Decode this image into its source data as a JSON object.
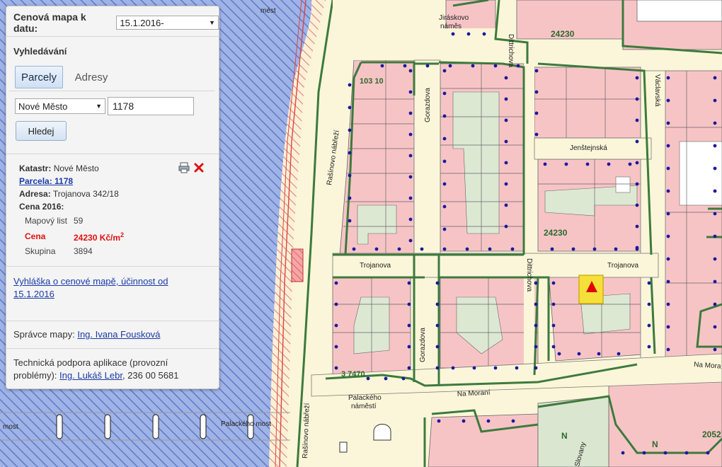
{
  "toolbar": {
    "title": "Cenová mapa k datu:",
    "date_value": "15.1.2016-",
    "caret": "▼"
  },
  "search": {
    "heading": "Vyhledávání",
    "tab_parcels": "Parcely",
    "tab_addresses": "Adresy",
    "cadastre_value": "Nové Město",
    "parcel_number": "1178",
    "search_button": "Hledej"
  },
  "result": {
    "cadastre_label": "Katastr:",
    "cadastre_value": "Nové Město",
    "parcel_link": "Parcela: 1178",
    "address_label": "Adresa:",
    "address_value": "Trojanova 342/18",
    "price_heading": "Cena 2016:",
    "map_sheet_label": "Mapový list",
    "map_sheet_value": "59",
    "price_label": "Cena",
    "price_value": "24230 Kč/m",
    "price_exp": "2",
    "group_label": "Skupina",
    "group_value": "3894"
  },
  "decree": {
    "link_line1": "Vyhláška o cenové mapě, účinnost od",
    "link_line2": "15.1.2016"
  },
  "admin": {
    "label": "Správce mapy:",
    "name": "Ing. Ivana Fousková"
  },
  "support": {
    "line1": "Technická podpora aplikace (provozní",
    "line2_prefix": "problémy):",
    "name": "Ing. Lukáš Lebr",
    "phone": ", 236 00 5681"
  },
  "map": {
    "streets": {
      "jiraskovo": "Jiráskovo",
      "jiraskovo2": "náměs",
      "dittrichova_top": "Dittrichova",
      "dittrichova_mid": "Dittrichova",
      "vaclavska": "Václavská",
      "gorazdova_top": "Gorazdova",
      "gorazdova_bot": "Gorazdova",
      "jenstejnska": "Jenštejnská",
      "trojanova_left": "Trojanova",
      "trojanova_right": "Trojanova",
      "rasinovo_top": "Rašínovo nábřeží",
      "rasinovo_bot": "Rašínovo nábřeží",
      "na_morani": "Na Moraní",
      "na_morani2": "Na Mora",
      "palackeho_sq1": "Palackého",
      "palackeho_sq2": "náměstí",
      "palackeho_most": "Palackého most",
      "most_left": "most",
      "most_top": "mést",
      "slovany": "Slovany"
    },
    "prices": {
      "p1": "24230",
      "p2": "24230",
      "p3": "103 10",
      "p4": "3 7470",
      "p5": "2052"
    },
    "zone_labels": {
      "n1": "N",
      "n2": "N"
    }
  },
  "colors": {
    "parcel_fill": "#f7c4c6",
    "street_fill": "#fbf6d9",
    "zone_border": "#3d7a3d",
    "river": "#8fa7e0",
    "point": "#1a1a9e",
    "selected": "#f5e03a",
    "marker": "#e00000"
  }
}
